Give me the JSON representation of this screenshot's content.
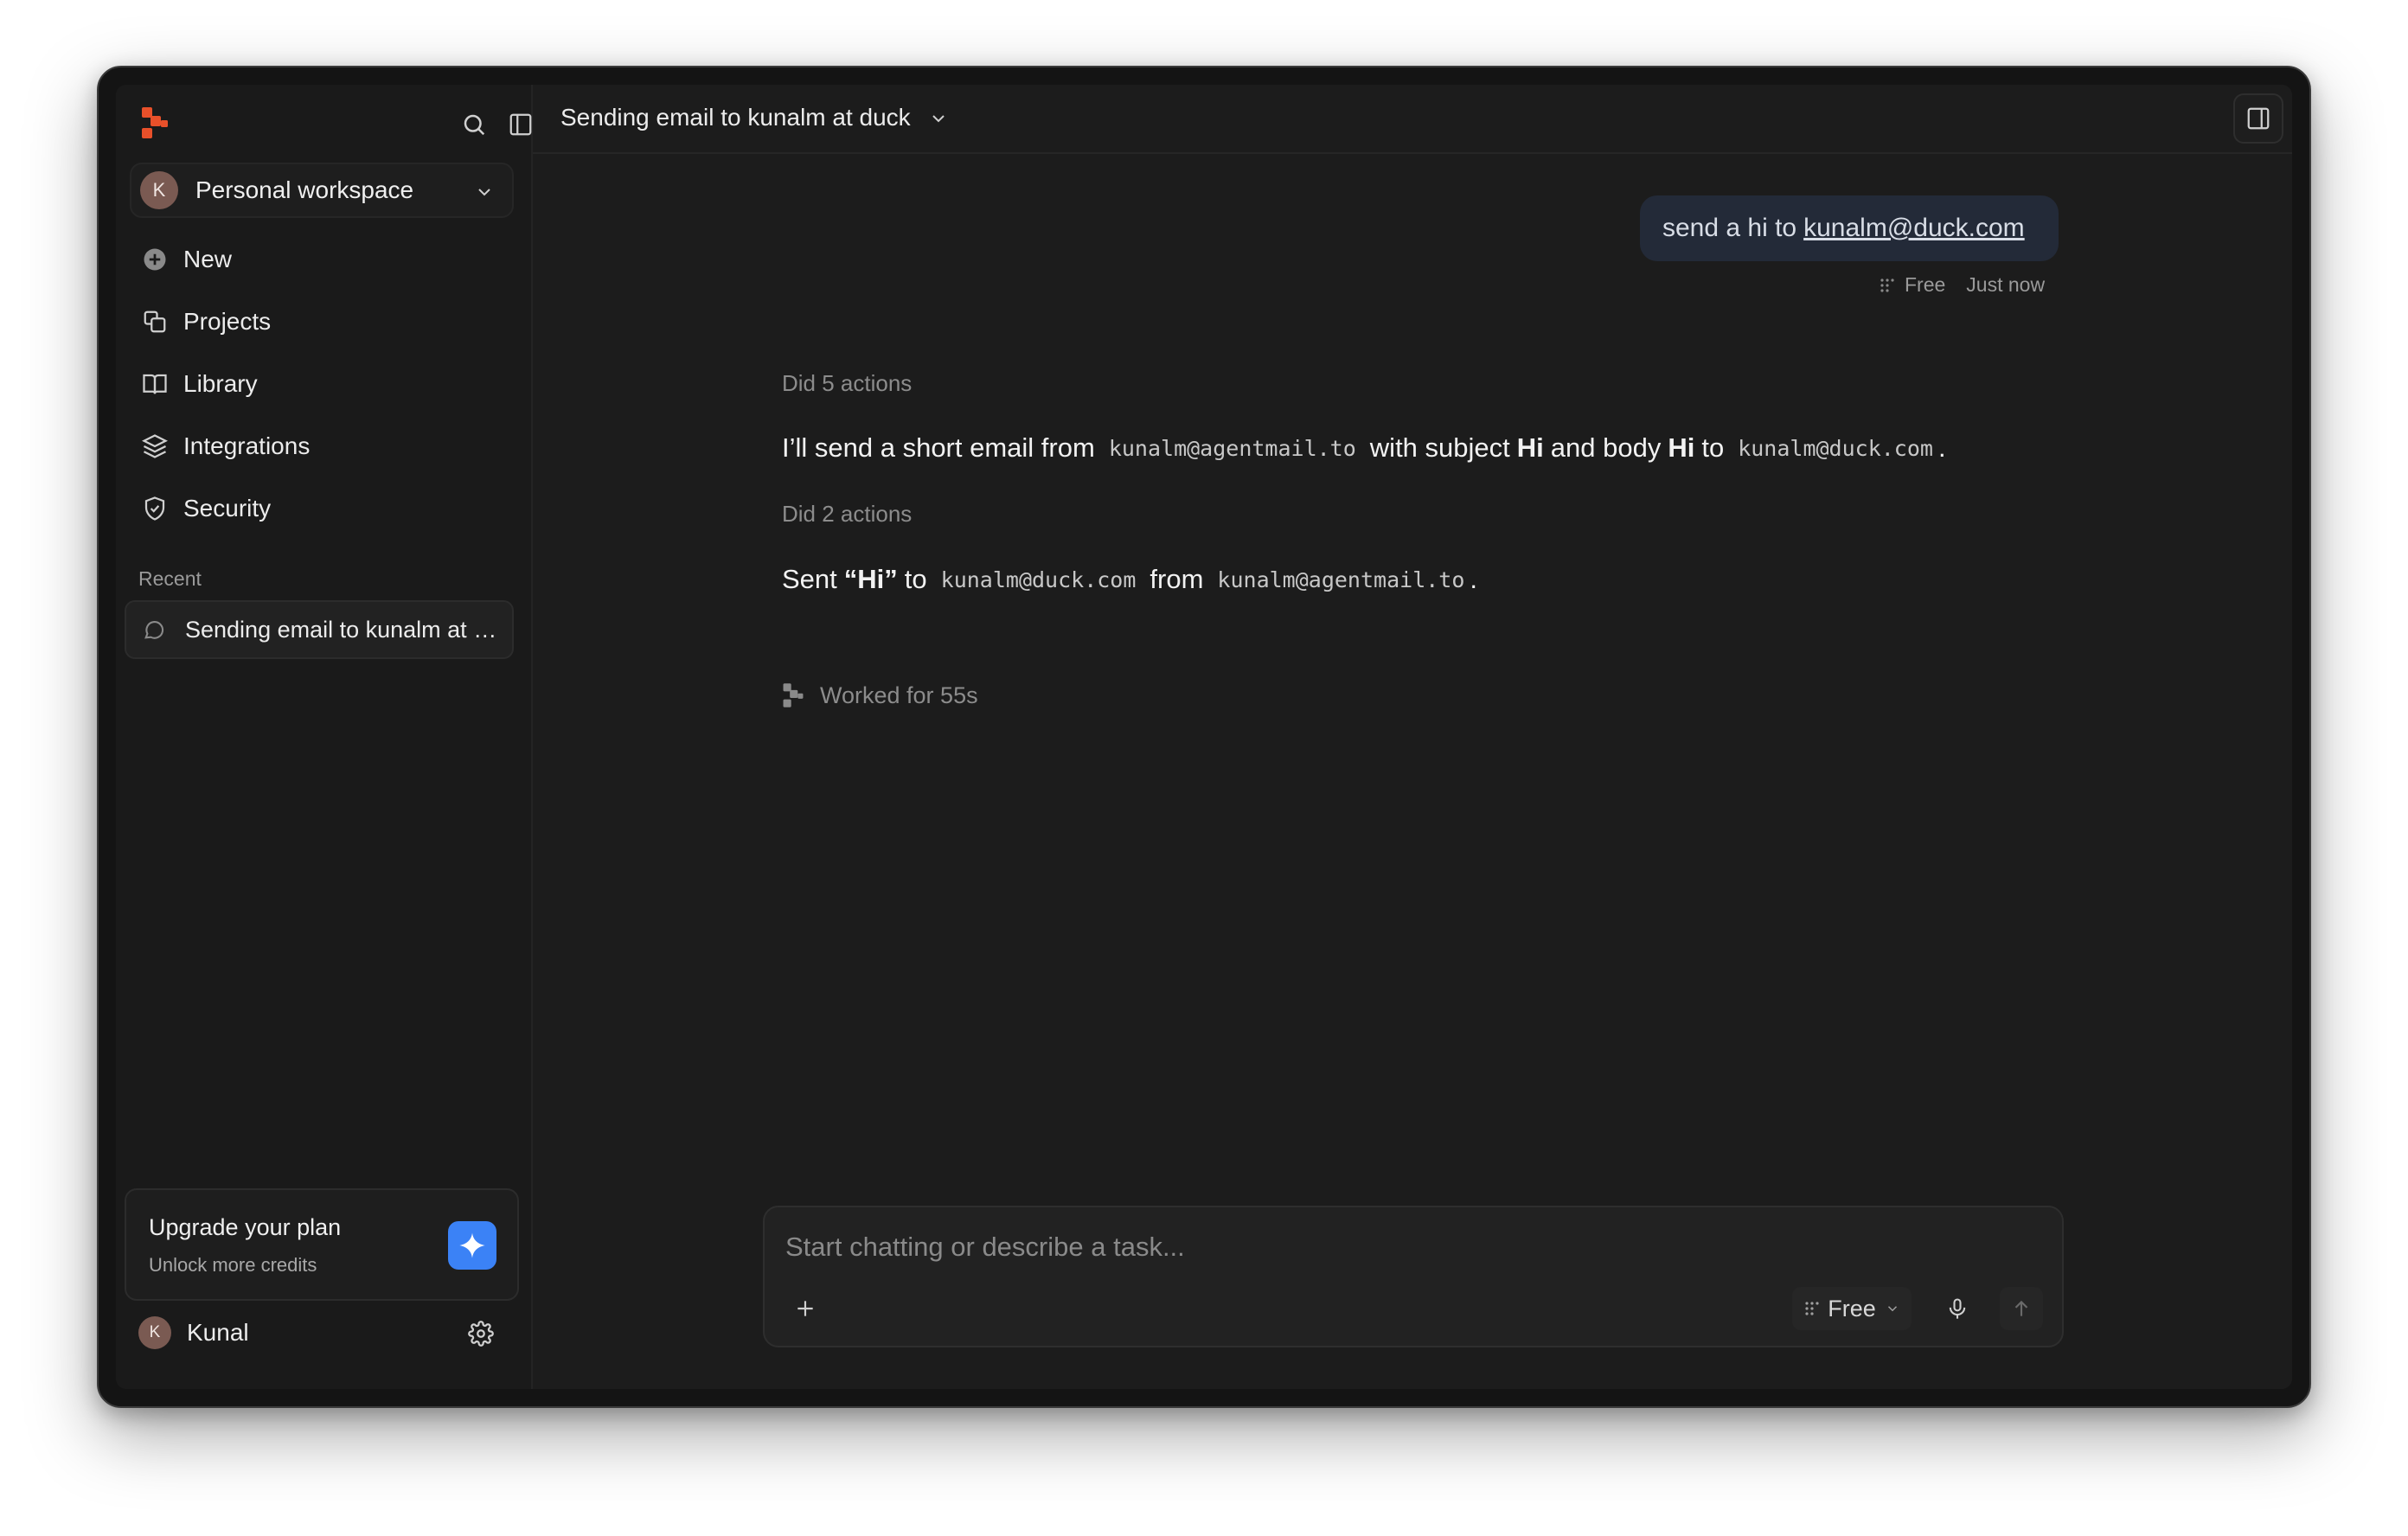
{
  "sidebar": {
    "workspace": {
      "avatar_initial": "K",
      "name": "Personal workspace"
    },
    "items": [
      {
        "label": "New",
        "icon": "plus-circle-icon"
      },
      {
        "label": "Projects",
        "icon": "projects-icon"
      },
      {
        "label": "Library",
        "icon": "book-icon"
      },
      {
        "label": "Integrations",
        "icon": "layers-icon"
      },
      {
        "label": "Security",
        "icon": "shield-icon"
      }
    ],
    "recent_label": "Recent",
    "recent": [
      {
        "label": "Sending email to kunalm at duck"
      }
    ],
    "upgrade": {
      "title": "Upgrade your plan",
      "subtitle": "Unlock more credits"
    },
    "user": {
      "avatar_initial": "K",
      "name": "Kunal"
    }
  },
  "header": {
    "title": "Sending email to kunalm at duck"
  },
  "chat": {
    "user_message": {
      "text": "send a hi to",
      "link": "kunalm@duck.com",
      "model": "Free",
      "time": "Just now"
    },
    "steps": [
      {
        "actions": "Did 5 actions"
      },
      {
        "actions": "Did 2 actions"
      }
    ],
    "msg1": {
      "t1": "I’ll send a short email from",
      "c1": "kunalm@agentmail.to",
      "t2": "with subject",
      "b1": "Hi",
      "t3": "and body",
      "b2": "Hi",
      "t4": "to",
      "c2": "kunalm@duck.com",
      "t5": "."
    },
    "msg2": {
      "t1": "Sent",
      "b1": "“Hi”",
      "t2": "to",
      "c1": "kunalm@duck.com",
      "t3": "from",
      "c2": "kunalm@agentmail.to",
      "t4": "."
    },
    "worked": "Worked for 55s"
  },
  "composer": {
    "placeholder": "Start chatting or describe a task...",
    "model": "Free"
  },
  "colors": {
    "accent": "#e8502a",
    "upgrade_button": "#3b82f6",
    "background": "#1c1c1c"
  }
}
